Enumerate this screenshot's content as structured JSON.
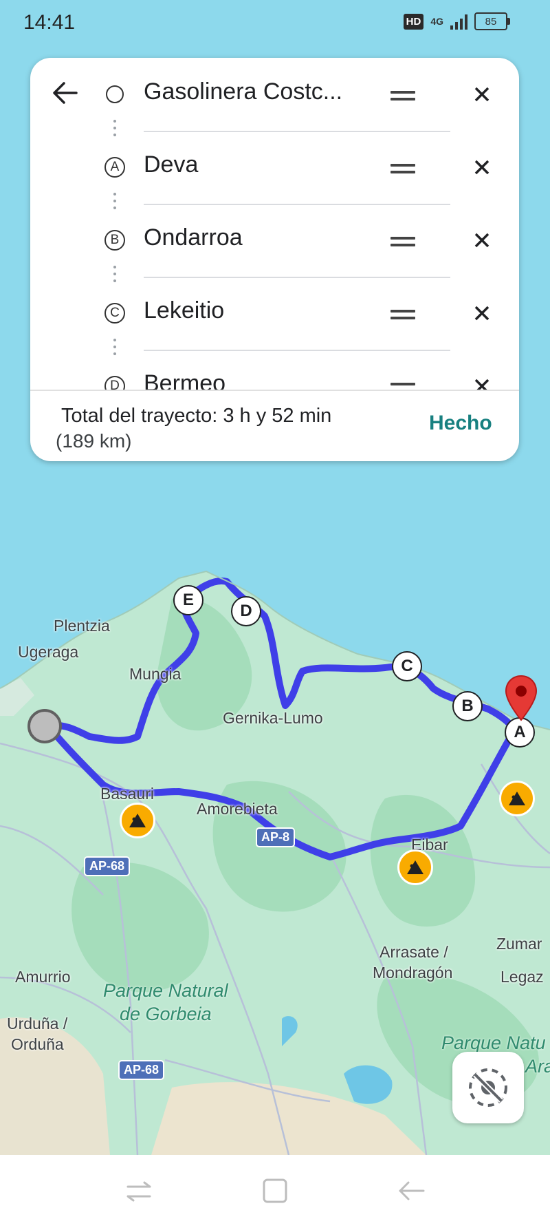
{
  "status_bar": {
    "time": "14:41",
    "hd": "HD",
    "network": "4G",
    "battery": "85"
  },
  "route_panel": {
    "stops": [
      {
        "marker": "",
        "name": "Gasolinera Costc..."
      },
      {
        "marker": "A",
        "name": "Deva"
      },
      {
        "marker": "B",
        "name": "Ondarroa"
      },
      {
        "marker": "C",
        "name": "Lekeitio"
      },
      {
        "marker": "D",
        "name": "Bermeo"
      }
    ],
    "total_label": "Total del trayecto: 3 h y 52 min",
    "distance": "(189 km)",
    "done_label": "Hecho"
  },
  "map": {
    "places": [
      "Plentzia",
      "Ugeraga",
      "Mungia",
      "Gernika-Lumo",
      "Basauri",
      "Amorebieta",
      "Eibar",
      "Arrasate /",
      "Mondragón",
      "Zumar",
      "Legaz",
      "Amurrio",
      "Urduña /",
      "Orduña"
    ],
    "parks": [
      {
        "line1": "Parque Natural",
        "line2": "de Gorbeia"
      },
      {
        "line1": "Parque Natu",
        "line2": "Ara"
      }
    ],
    "roads": [
      "AP-8",
      "AP-68",
      "AP-68"
    ],
    "waypoints": [
      "E",
      "D",
      "C",
      "B",
      "A"
    ],
    "colors": {
      "route": "#3f3fe8",
      "sea": "#8dd9ec",
      "land": "#bfe8d2",
      "forest": "#9fd9b5",
      "road_shield": "#4e6fb8",
      "destination_pin": "#e53935",
      "construction": "#f9ab00",
      "accent": "#188080"
    }
  }
}
